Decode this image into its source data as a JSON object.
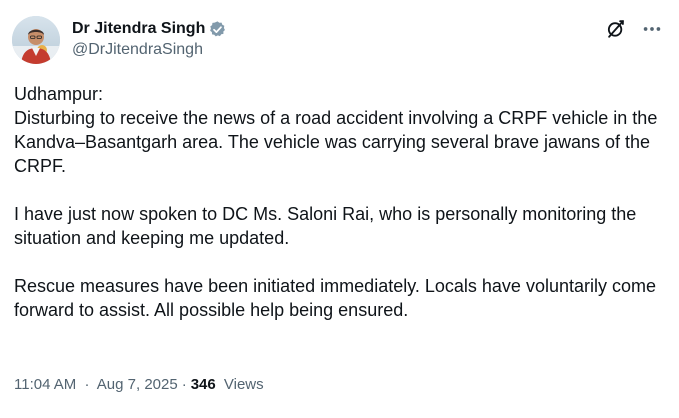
{
  "author": {
    "display_name": "Dr Jitendra Singh",
    "handle": "@DrJitendraSingh",
    "verified_badge_color": "#829aab",
    "avatar_icon": "avatar-photo"
  },
  "actions": {
    "grok_icon": "grok-icon",
    "more_icon": "more-options-icon"
  },
  "tweet": {
    "paragraphs": [
      "Udhampur:\nDisturbing to receive the news of a road accident involving a CRPF vehicle in the Kandva–Basantgarh area. The vehicle was carrying several brave jawans of the CRPF.",
      "I have just now spoken to DC Ms. Saloni Rai, who is personally monitoring the situation and keeping me updated.",
      "Rescue measures have been initiated immediately. Locals have voluntarily come forward to assist. All possible help being ensured."
    ]
  },
  "meta": {
    "time": "11:04 AM",
    "separator": "·",
    "date": "Aug 7, 2025",
    "views_count": "346",
    "views_label": "Views"
  }
}
